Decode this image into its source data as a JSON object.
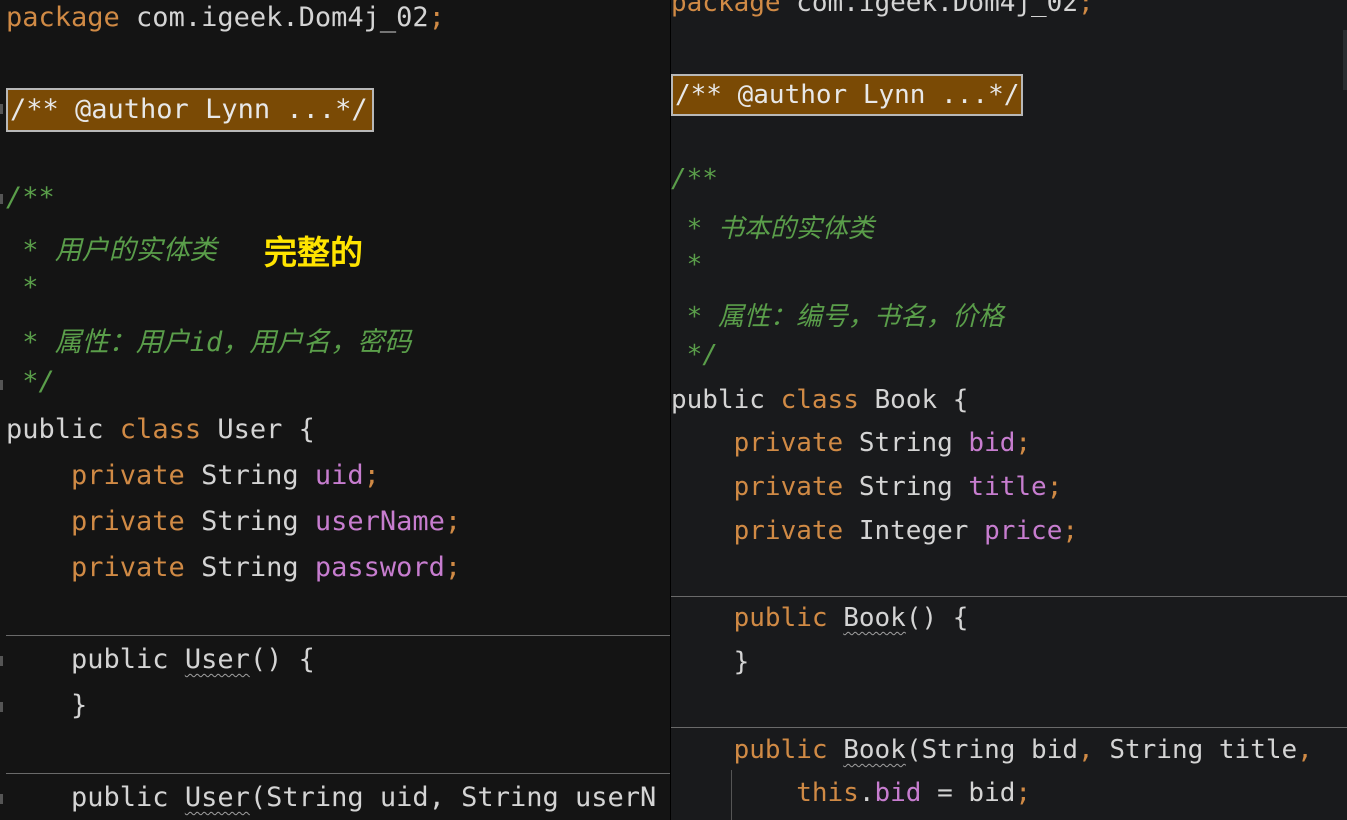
{
  "left_editor": {
    "package": {
      "kw": "package",
      "name": " com.igeek.Dom4j_02",
      "semi": ";"
    },
    "folded_comment": "/** @author Lynn ...*/",
    "doc_open": "/**",
    "doc_line1": " * 用户的实体类",
    "callout": "完整的",
    "doc_star": " *",
    "doc_line2": " * 属性：用户id，用户名，密码",
    "doc_close": " */",
    "class_decl": {
      "kw1": "public",
      "kw2": " class",
      "name": " User {"
    },
    "fields": [
      {
        "kw": "    private",
        "type": " String ",
        "name": "uid",
        "semi": ";"
      },
      {
        "kw": "    private",
        "type": " String ",
        "name": "userName",
        "semi": ";"
      },
      {
        "kw": "    private",
        "type": " String ",
        "name": "password",
        "semi": ";"
      }
    ],
    "ctor1": {
      "kw": "    public",
      "gap": " ",
      "name": "User",
      "rest": "() {"
    },
    "ctor1_close": "    }",
    "ctor2": {
      "kw": "    public",
      "gap": " ",
      "name": "User",
      "rest": "(String uid, String userN"
    }
  },
  "right_editor": {
    "package": {
      "kw": "package",
      "name": " com.igeek.Dom4j_02",
      "semi": ";"
    },
    "folded_comment": "/** @author Lynn ...*/",
    "doc_open": "/**",
    "doc_line1": " * 书本的实体类",
    "doc_star": " *",
    "doc_line2": " * 属性：编号，书名，价格",
    "doc_close": " */",
    "class_decl": {
      "kw1": "public",
      "kw2": " class",
      "name": " Book {"
    },
    "fields": [
      {
        "kw": "    private",
        "type": " String ",
        "name": "bid",
        "semi": ";"
      },
      {
        "kw": "    private",
        "type": " String ",
        "name": "title",
        "semi": ";"
      },
      {
        "kw": "    private",
        "type": " Integer ",
        "name": "price",
        "semi": ";"
      }
    ],
    "ctor1": {
      "kw": "    public",
      "gap": " ",
      "name": "Book",
      "rest": "() {"
    },
    "ctor1_close": "    }",
    "ctor2": {
      "kw": "    public",
      "gap": " ",
      "name": "Book",
      "p1": "(String bid",
      "c1": ",",
      "p2": " String title",
      "c2": ","
    },
    "this_line": {
      "kw": "        this",
      "dot": ".",
      "field": "bid",
      "rest": " = bid",
      "semi": ";"
    }
  },
  "colors": {
    "keyword": "#d08a45",
    "field": "#c77dcf",
    "comment": "#5a9e4a",
    "callout": "#ffe400",
    "fold_bg": "#7a4a05"
  }
}
